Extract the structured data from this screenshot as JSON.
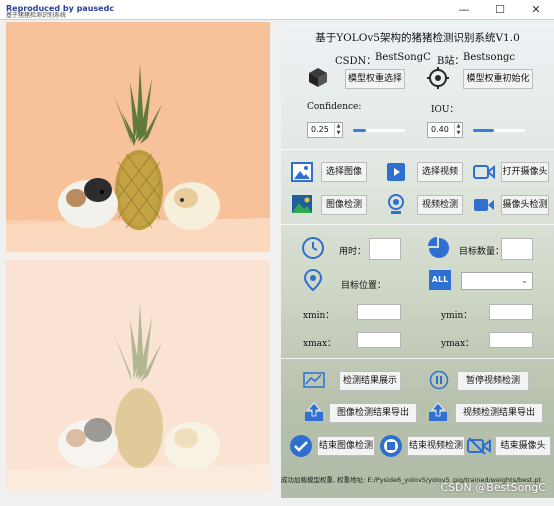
{
  "window": {
    "title": "Reproduced by pausedc",
    "subtitle": "基于猪猪检测识别系统",
    "minimize": "—",
    "maximize": "☐",
    "close": "✕"
  },
  "header": {
    "title": "基于YOLOv5架构的猪猪检测识别系统V1.0",
    "csdn_label": "CSDN：",
    "csdn_value": "BestSongC",
    "bili_label": "B站：",
    "bili_value": "Bestsongc"
  },
  "model": {
    "select_button": "模型权重选择",
    "init_button": "模型权重初始化"
  },
  "params": {
    "confidence_label": "Confidence:",
    "confidence_value": "0.25",
    "iou_label": "IOU：",
    "iou_value": "0.40",
    "confidence_level": 0.25,
    "iou_level": 0.4
  },
  "media": {
    "select_image": "选择图像",
    "select_video": "选择视频",
    "open_camera": "打开摄像头",
    "image_detect": "图像检测",
    "video_detect": "视频检测",
    "camera_detect": "摄像头检测"
  },
  "stats": {
    "time_label": "用时：",
    "count_label": "目标数量：",
    "position_label": "目标位置：",
    "xmin_label": "xmin：",
    "ymin_label": "ymin：",
    "xmax_label": "xmax：",
    "ymax_label": "ymax："
  },
  "actions": {
    "show_results": "检测结果展示",
    "pause_video": "暂停视频检测",
    "export_image": "图像检测结果导出",
    "export_video": "视频检测结果导出",
    "end_image": "结束图像检测",
    "end_video": "结束视频检测",
    "end_camera": "结束摄像头"
  },
  "status": {
    "message": "成功加载模型权重, 权重地址: E:/Pyside6_yolov5/yolov5_pig/trained/weights/best.pt"
  },
  "watermark": "CSDN @BestSongC",
  "colors": {
    "accent_blue": "#3d7be0",
    "icon_blue": "#2f6fd0",
    "source_bg": "#f7c7a0"
  }
}
